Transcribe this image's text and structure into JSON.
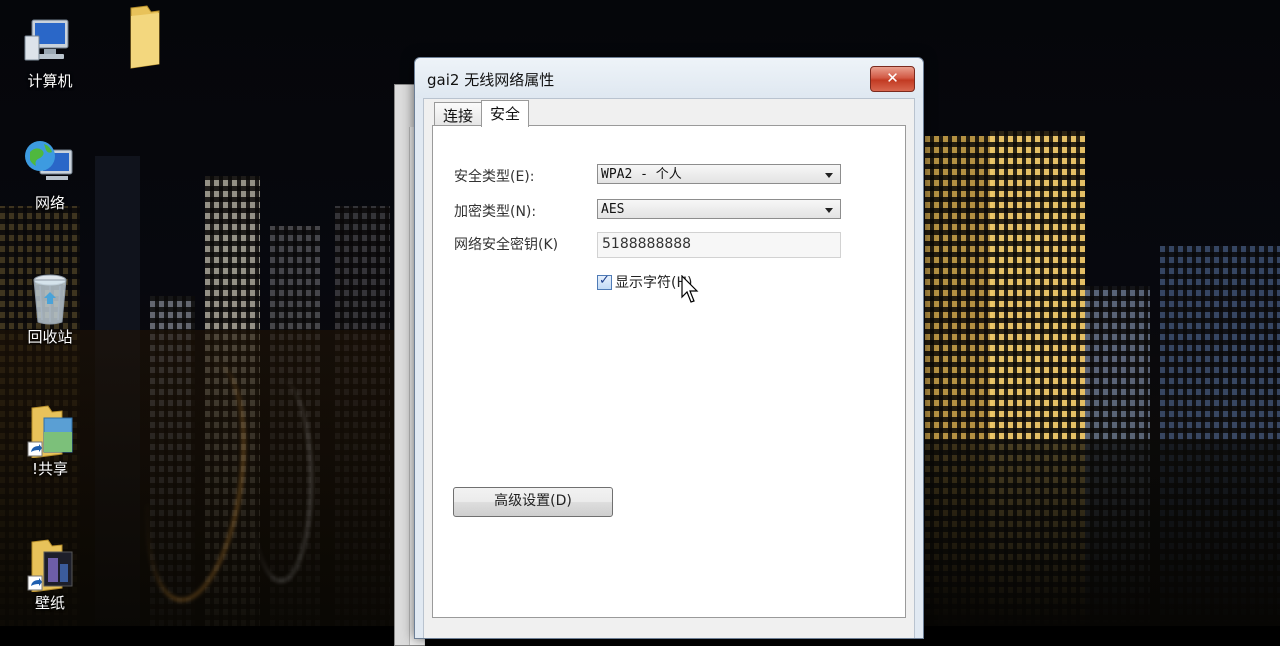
{
  "desktop": {
    "icons": [
      {
        "label": "计算机",
        "icon": "computer-icon"
      },
      {
        "label": "",
        "icon": "folder-icon"
      },
      {
        "label": "网络",
        "icon": "network-globe-icon"
      },
      {
        "label": "回收站",
        "icon": "recycle-bin-icon"
      },
      {
        "label": "!共享",
        "icon": "shared-folder-shortcut-icon"
      },
      {
        "label": "壁纸",
        "icon": "wallpaper-folder-shortcut-icon"
      }
    ]
  },
  "dialog": {
    "title": "gai2 无线网络属性",
    "close_label": "✕",
    "tabs": [
      {
        "label": "连接",
        "active": false
      },
      {
        "label": "安全",
        "active": true
      }
    ],
    "security": {
      "security_type_label": "安全类型(E):",
      "security_type_value": "WPA2 - 个人",
      "encryption_type_label": "加密类型(N):",
      "encryption_type_value": "AES",
      "key_label": "网络安全密钥(K)",
      "key_value": "5188888888",
      "show_chars_label": "显示字符(H)",
      "show_chars_checked": true,
      "advanced_button_label": "高级设置(D)"
    }
  },
  "colors": {
    "close_button": "#c9432c",
    "dialog_frame": "#e1e9f2"
  }
}
